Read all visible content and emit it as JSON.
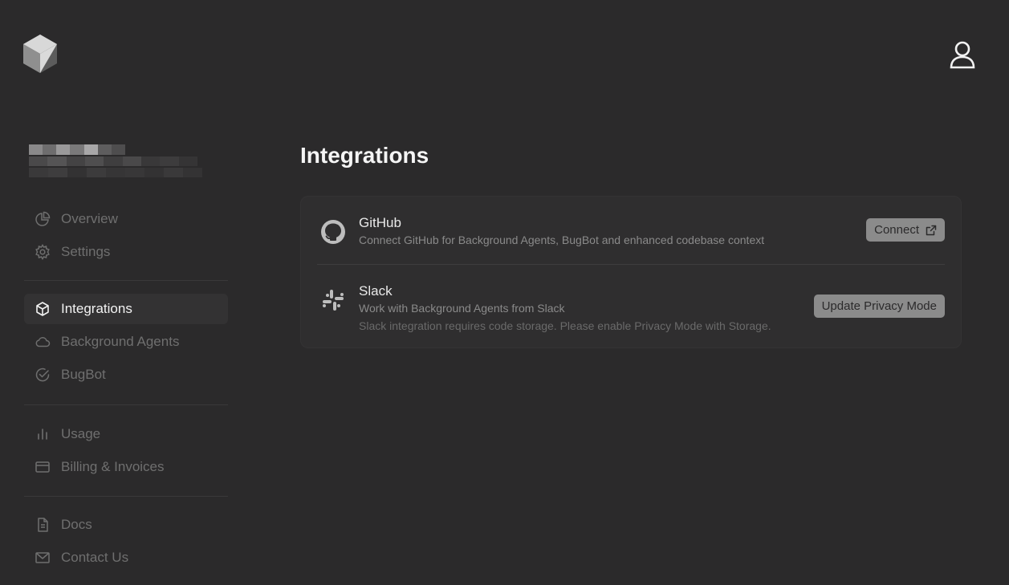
{
  "header": {
    "logo_icon": "cube-logo-icon",
    "avatar_icon": "user-icon"
  },
  "sidebar": {
    "groups": [
      [
        {
          "label": "Overview",
          "icon": "pie-chart-icon"
        },
        {
          "label": "Settings",
          "icon": "gear-icon"
        }
      ],
      [
        {
          "label": "Integrations",
          "icon": "box-icon",
          "active": true
        },
        {
          "label": "Background Agents",
          "icon": "cloud-icon"
        },
        {
          "label": "BugBot",
          "icon": "check-circle-icon"
        }
      ],
      [
        {
          "label": "Usage",
          "icon": "bar-chart-icon"
        },
        {
          "label": "Billing & Invoices",
          "icon": "credit-card-icon"
        }
      ],
      [
        {
          "label": "Docs",
          "icon": "document-icon"
        },
        {
          "label": "Contact Us",
          "icon": "mail-icon"
        }
      ]
    ]
  },
  "main": {
    "title": "Integrations",
    "integrations": [
      {
        "name": "GitHub",
        "description": "Connect GitHub for Background Agents, BugBot and enhanced codebase context",
        "button": "Connect",
        "icon": "github-icon"
      },
      {
        "name": "Slack",
        "description": "Work with Background Agents from Slack",
        "note": "Slack integration requires code storage. Please enable Privacy Mode with Storage.",
        "button": "Update Privacy Mode",
        "icon": "slack-icon"
      }
    ]
  },
  "colors": {
    "background": "#2b2a2b",
    "card": "#2f2e2f",
    "button": "#8b8b8b",
    "active_nav": "#333233"
  }
}
